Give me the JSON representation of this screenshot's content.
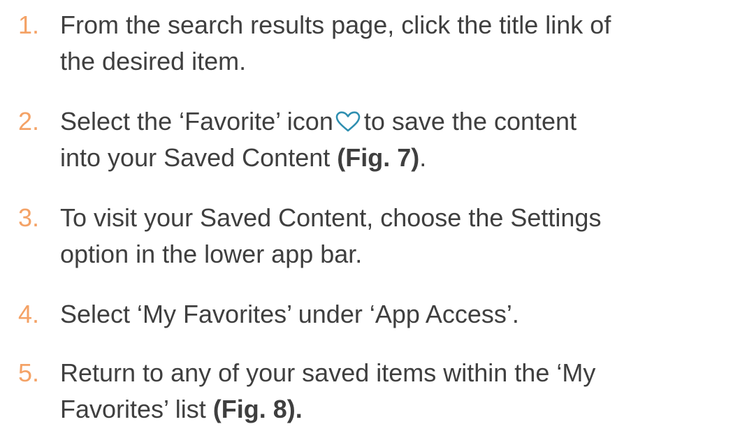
{
  "icons": {
    "favorite": "heart-outline-icon"
  },
  "colors": {
    "number": "#f4a266",
    "text": "#3f3f3f",
    "heart": "#2f8fb0"
  },
  "steps": [
    {
      "number": "1.",
      "line1": "From the search results page, click the title link of",
      "line2": "the desired item."
    },
    {
      "number": "2.",
      "line1_before": "Select the ‘Favorite’ icon",
      "line1_after": "to save the content",
      "line2_text": "into your Saved Content ",
      "line2_bold": "(Fig. 7)",
      "line2_end": "."
    },
    {
      "number": "3.",
      "line1": "To visit your Saved Content, choose the Settings",
      "line2": "option in the lower app bar."
    },
    {
      "number": "4.",
      "line1": "Select ‘My Favorites’ under ‘App Access’."
    },
    {
      "number": "5.",
      "line1": "Return to any of your saved items within the ‘My",
      "line2_text": "Favorites’ list ",
      "line2_bold": "(Fig. 8)."
    }
  ]
}
